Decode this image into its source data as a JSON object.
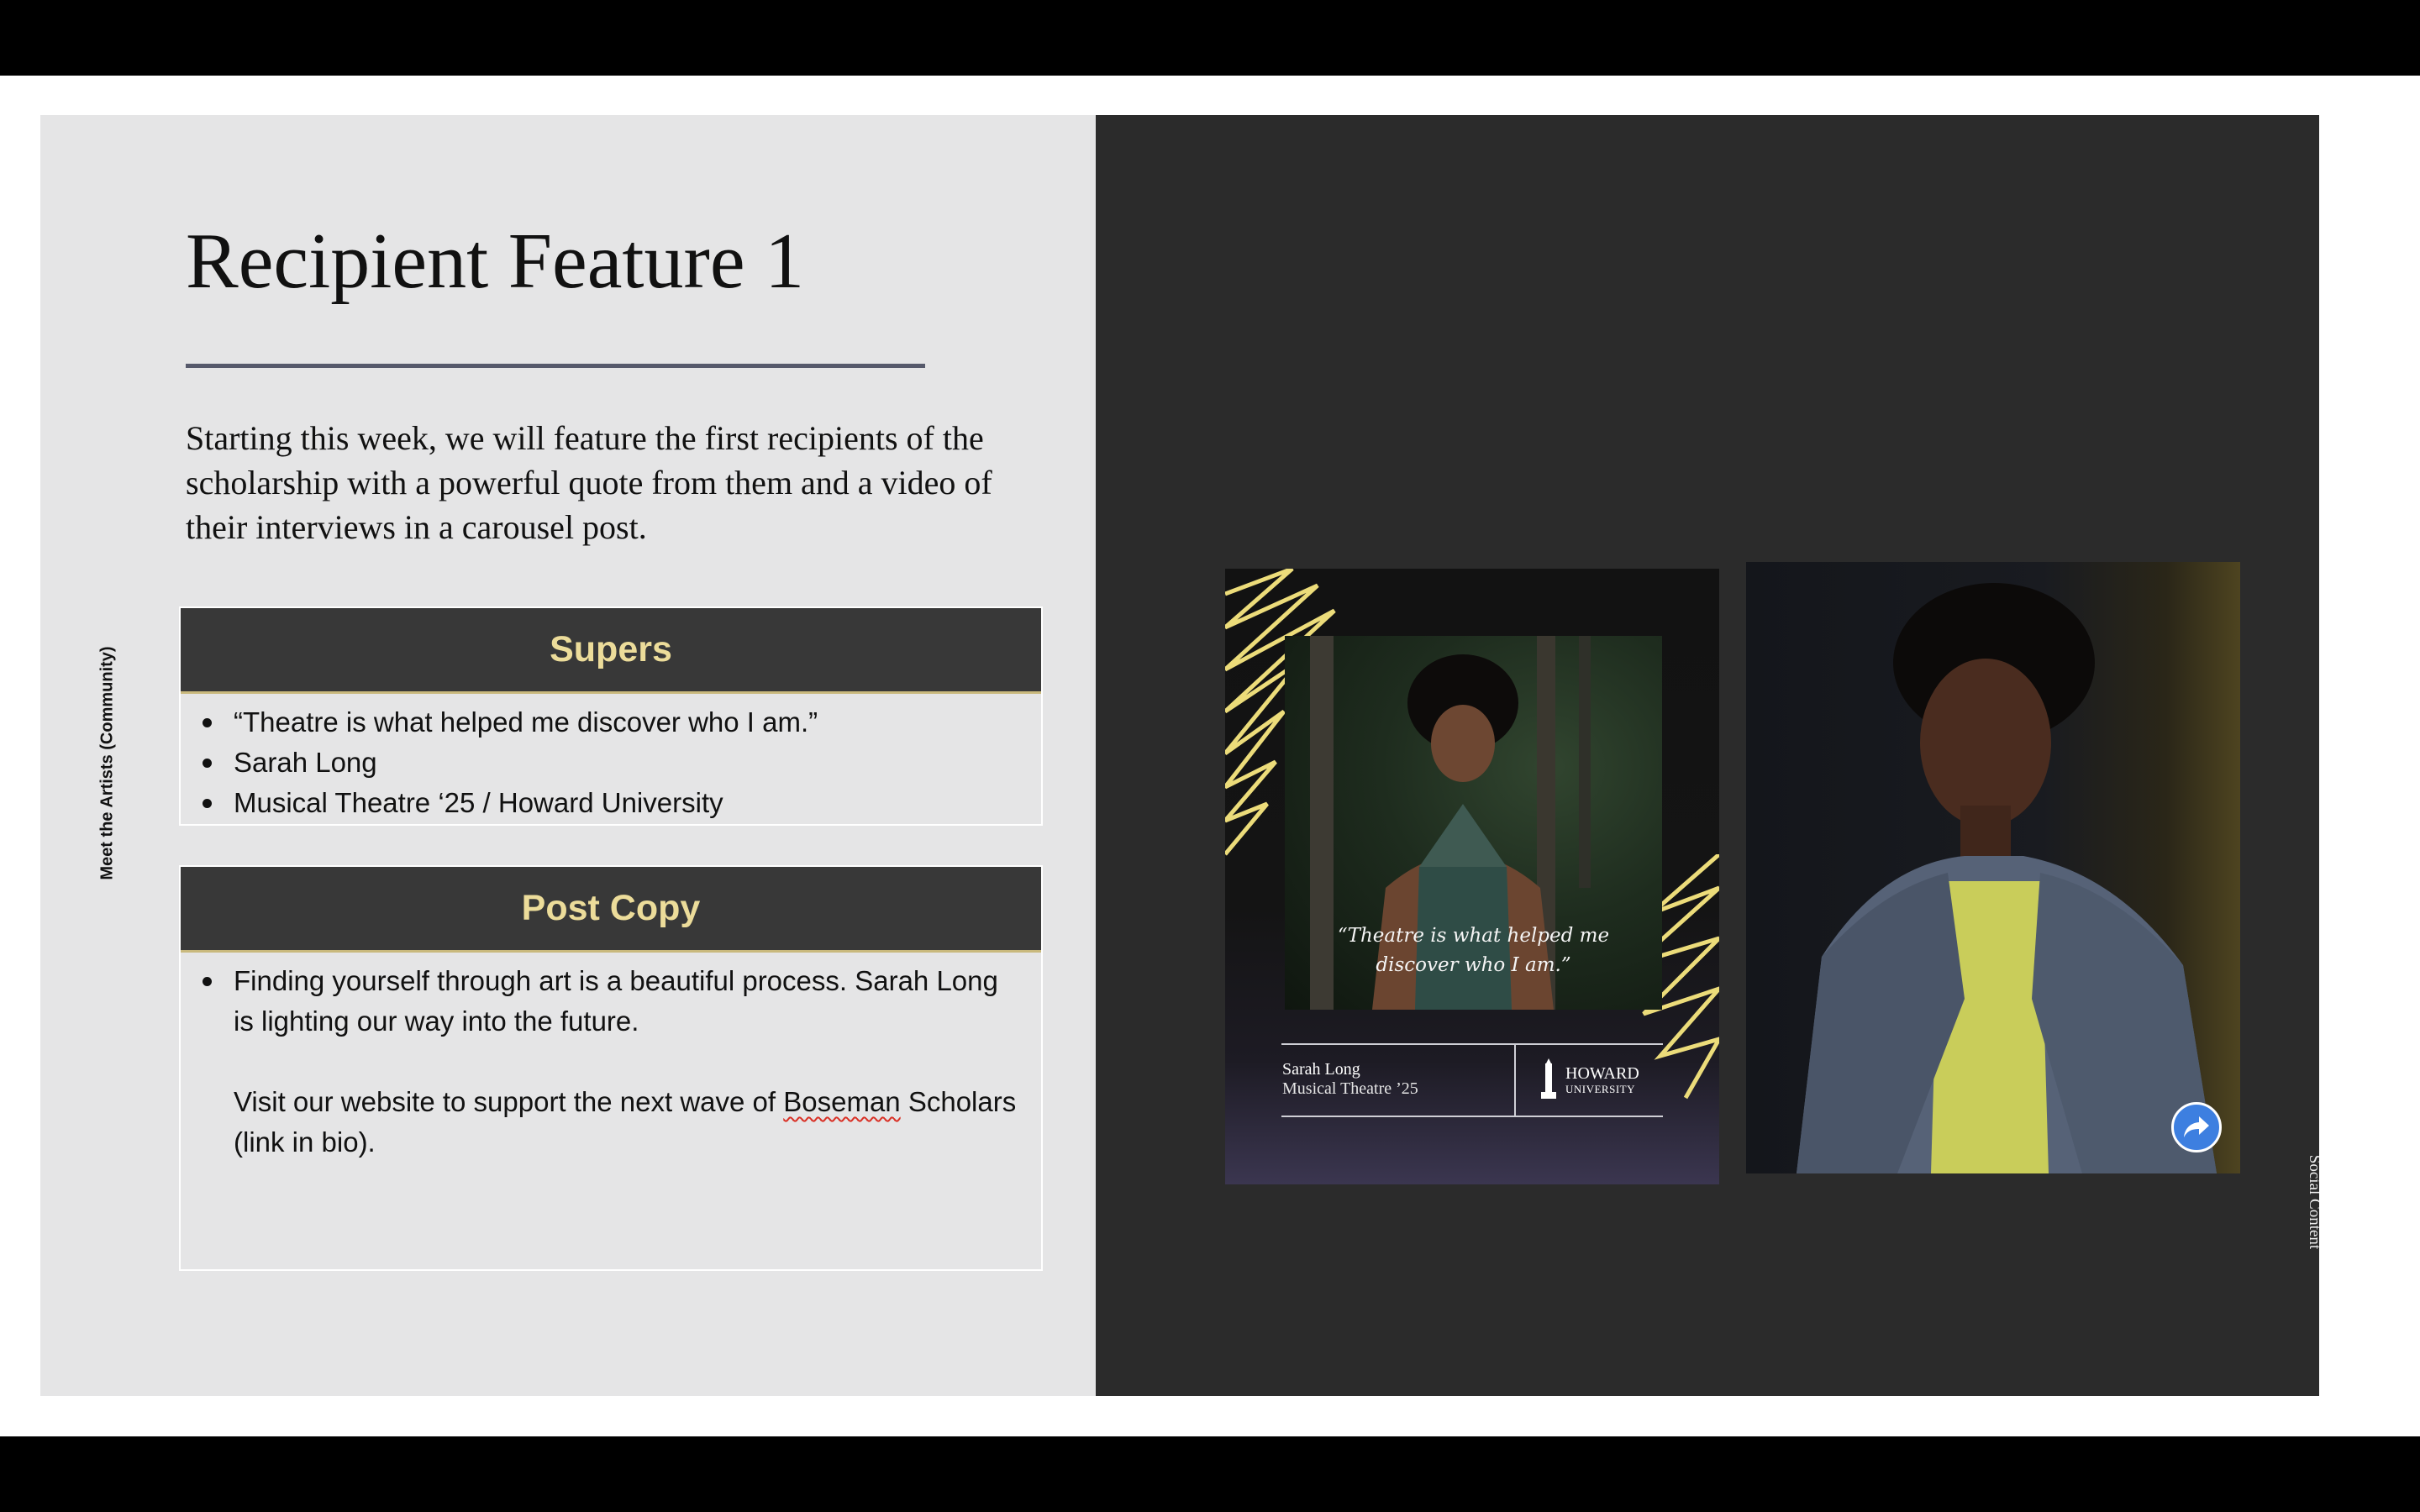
{
  "slide": {
    "title": "Recipient Feature 1",
    "intro": "Starting this week, we will feature the first recipients of the scholarship with a powerful quote from them and a video of their interviews in a carousel post.",
    "side_label_left": "Meet the Artists (Community)",
    "side_label_right": "Social Content"
  },
  "supers": {
    "header": "Supers",
    "items": [
      "“Theatre is what helped me discover who I am.”",
      "Sarah Long",
      "Musical Theatre ‘25 / Howard University"
    ]
  },
  "post_copy": {
    "header": "Post Copy",
    "line1": "Finding yourself through art is a beautiful process. Sarah Long is lighting our way into the future.",
    "line2_before": "Visit our website to support the next wave of ",
    "line2_misspelled": "Boseman",
    "line2_after": " Scholars (link in bio)."
  },
  "post_card": {
    "quote_line1": "“Theatre is what helped me",
    "quote_line2": "discover who I am.”",
    "name": "Sarah Long",
    "major": "Musical Theatre ’25",
    "logo_line1": "HOWARD",
    "logo_line2": "UNIVERSITY"
  },
  "colors": {
    "header_bg": "#383838",
    "header_text": "#ecdc9a",
    "accent_gold": "#c9b97d",
    "rule": "#56596b",
    "share_blue": "#3d7fe0"
  },
  "icons": {
    "share": "share-arrow-icon",
    "logo": "howard-tower-icon"
  }
}
